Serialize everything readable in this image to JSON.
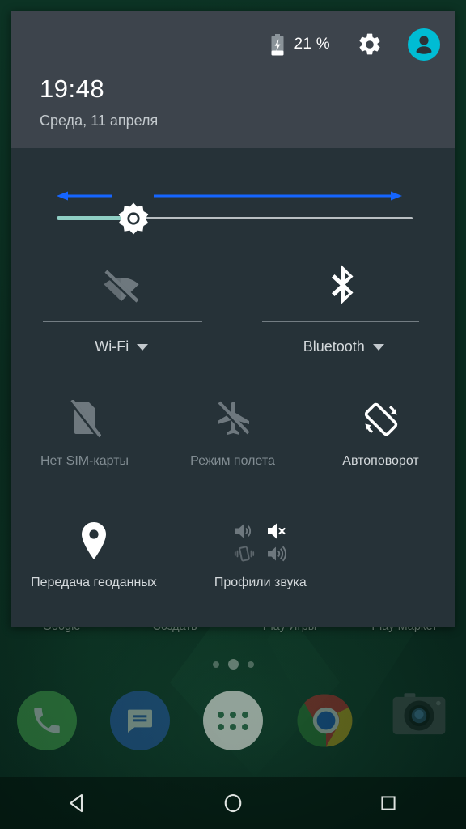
{
  "colors": {
    "panel_header": "#3d444c",
    "panel_body": "#263238",
    "accent_avatar": "#00bcd4",
    "annotation_arrow": "#1565ff",
    "slider_fill": "#8fcfc4",
    "wallpaper": "#0a2a1e",
    "label_on": "#d4d9dc",
    "label_off": "#828d93"
  },
  "status_bar": {
    "battery_icon": "battery-charging-icon",
    "battery_level_percent": 21,
    "battery_text": "21 %",
    "settings_icon": "gear-icon",
    "user_icon": "user-avatar-icon"
  },
  "header": {
    "time": "19:48",
    "date": "Среда, 11 апреля"
  },
  "brightness": {
    "icon": "brightness-sun-icon",
    "value_percent": 20,
    "annotation_left_arrow": "arrow-left-icon",
    "annotation_right_arrow": "arrow-right-icon"
  },
  "tiles_large": [
    {
      "label": "Wi-Fi",
      "icon": "wifi-off-icon",
      "state": "off",
      "has_dropdown": true,
      "dropdown_icon": "chevron-down-icon"
    },
    {
      "label": "Bluetooth",
      "icon": "bluetooth-icon",
      "state": "on",
      "has_dropdown": true,
      "dropdown_icon": "chevron-down-icon"
    }
  ],
  "tiles_row2": [
    {
      "label": "Нет SIM-карты",
      "icon": "sim-card-off-icon",
      "state": "off"
    },
    {
      "label": "Режим полета",
      "icon": "airplane-mode-icon",
      "state": "off"
    },
    {
      "label": "Автоповорот",
      "icon": "auto-rotate-icon",
      "state": "on"
    }
  ],
  "tiles_row3": [
    {
      "label": "Передача геоданных",
      "icon": "location-pin-icon",
      "state": "on"
    },
    {
      "label": "Профили звука",
      "icon": "sound-profiles-icon",
      "state": "on",
      "sound_icons": [
        "speaker-icon",
        "speaker-mute-icon",
        "vibrate-icon",
        "speaker-loud-icon"
      ],
      "selected_sound_icon": "speaker-mute-icon"
    }
  ],
  "home_screen": {
    "app_labels": [
      "Google",
      "Создать",
      "Play Игры",
      "Play Маркет"
    ],
    "page_dots": {
      "count": 3,
      "active_index": 1
    },
    "dock": [
      {
        "name": "Phone",
        "icon": "phone-icon"
      },
      {
        "name": "Messages",
        "icon": "messages-icon"
      },
      {
        "name": "App drawer",
        "icon": "app-drawer-icon"
      },
      {
        "name": "Chrome",
        "icon": "chrome-icon"
      },
      {
        "name": "Camera",
        "icon": "camera-icon"
      }
    ]
  },
  "nav_bar": {
    "back": "back-triangle-icon",
    "home": "home-circle-icon",
    "recents": "recents-square-icon"
  }
}
